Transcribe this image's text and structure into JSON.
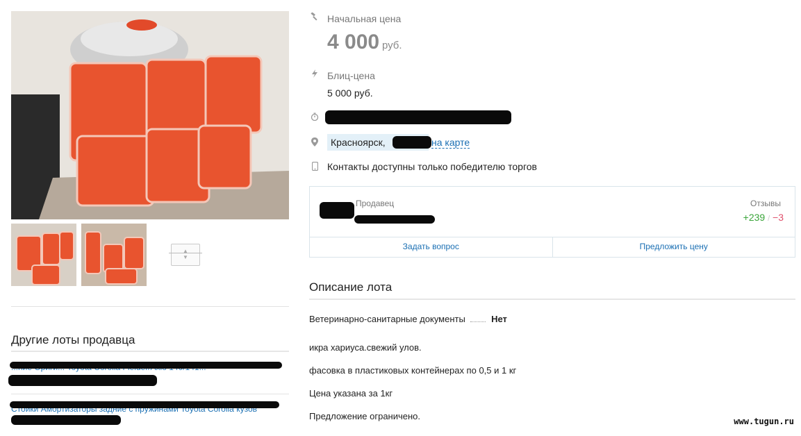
{
  "price": {
    "start_label": "Начальная цена",
    "amount": "4 000",
    "currency": "руб.",
    "blitz_label": "Блиц-цена",
    "blitz_value": "5 000 руб."
  },
  "location": {
    "city": "Красноярск,",
    "map_link": "на карте"
  },
  "contacts_text": "Контакты доступны только победителю торгов",
  "seller": {
    "label": "Продавец",
    "reviews_label": "Отзывы",
    "positive": "+239",
    "separator": "/",
    "negative": "−3",
    "ask_button": "Задать вопрос",
    "offer_button": "Предложить цену"
  },
  "description": {
    "title": "Описание лота",
    "docs_label": "Ветеринарно-санитарные документы",
    "docs_value": "Нет",
    "lines": [
      "икра хариуса.свежий улов.",
      "фасовка в пластиковых контейнерах по 0,5 и 1 кг",
      "Цена указана за 1кг",
      "Предложение ограничено."
    ]
  },
  "other_lots": {
    "title": "Другие лоты продавца",
    "items": [
      "...ние Ориги... Toyota Corolla Fielder/Axio 140/141...",
      "Стойки Амортизаторы задние с пружинами Toyota Corolla кузов"
    ]
  },
  "watermark": "www.tugun.ru",
  "colors": {
    "link": "#1a6fb3",
    "positive": "#3aa53a",
    "negative": "#e0506c"
  },
  "icons": [
    "hammer-icon",
    "lightning-icon",
    "clock-icon",
    "map-pin-icon",
    "phone-icon"
  ]
}
